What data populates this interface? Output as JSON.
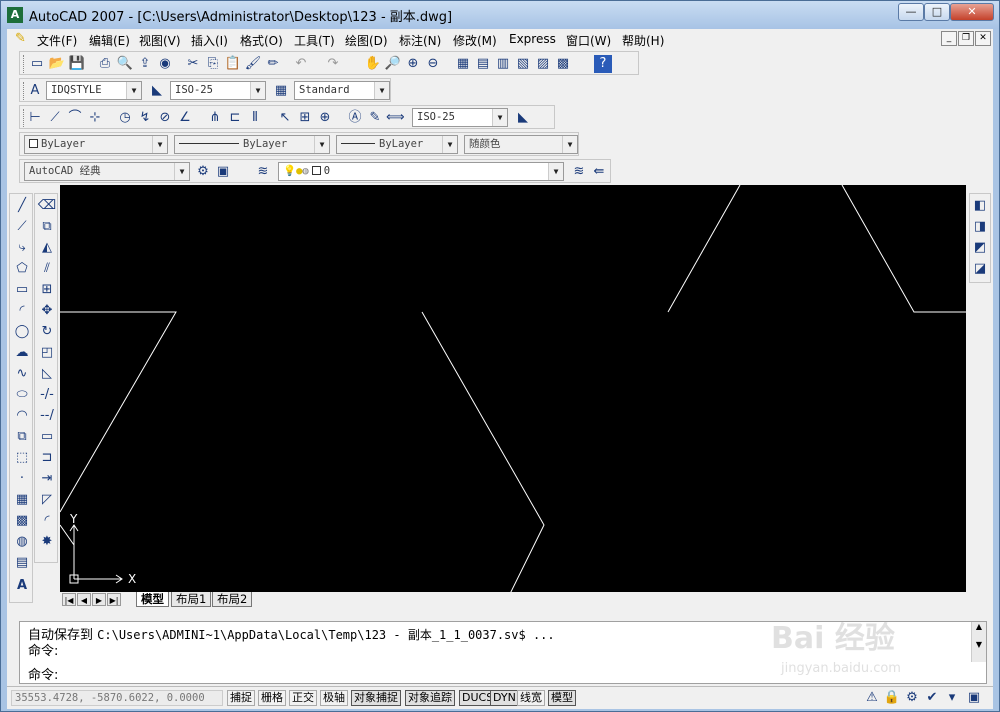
{
  "window": {
    "title": "AutoCAD 2007 - [C:\\Users\\Administrator\\Desktop\\123 - 副本.dwg]",
    "app_icon": "A",
    "min": "—",
    "max": "□",
    "close": "✕"
  },
  "menu": {
    "items": [
      "文件(F)",
      "编辑(E)",
      "视图(V)",
      "插入(I)",
      "格式(O)",
      "工具(T)",
      "绘图(D)",
      "标注(N)",
      "修改(M)",
      "Express",
      "窗口(W)",
      "帮助(H)"
    ],
    "mdi_min": "_",
    "mdi_restore": "❐",
    "mdi_close": "✕"
  },
  "toolbar_text": {
    "text_style": "IDQSTYLE",
    "dim_style": "ISO-25",
    "table_style": "Standard"
  },
  "toolbar_dim": {
    "dim_style": "ISO-25"
  },
  "toolbar_props": {
    "color": "ByLayer",
    "linetype": "ByLayer",
    "lineweight": "ByLayer",
    "plotstyle": "随颜色"
  },
  "toolbar_workspace": {
    "workspace": "AutoCAD 经典",
    "layer": "0"
  },
  "tabs": {
    "model": "模型",
    "layout1": "布局1",
    "layout2": "布局2"
  },
  "command": {
    "line1_prefix": "自动保存到",
    "line1_path": "C:\\Users\\ADMINI~1\\AppData\\Local\\Temp\\123 - 副本_1_1_0037.sv$ ...",
    "line2": "命令:",
    "line3": "命令:"
  },
  "status": {
    "coords": "35553.4728, -5870.6022, 0.0000",
    "buttons": [
      "捕捉",
      "栅格",
      "正交",
      "极轴",
      "对象捕捉",
      "对象追踪",
      "DUCS",
      "DYN",
      "线宽",
      "模型"
    ]
  },
  "ucs": {
    "x_label": "X",
    "y_label": "Y"
  },
  "watermark": {
    "brand": "Bai 经验",
    "url": "jingyan.baidu.com"
  },
  "colors": {
    "canvas_bg": "#000000",
    "line_color": "#ffffff"
  }
}
